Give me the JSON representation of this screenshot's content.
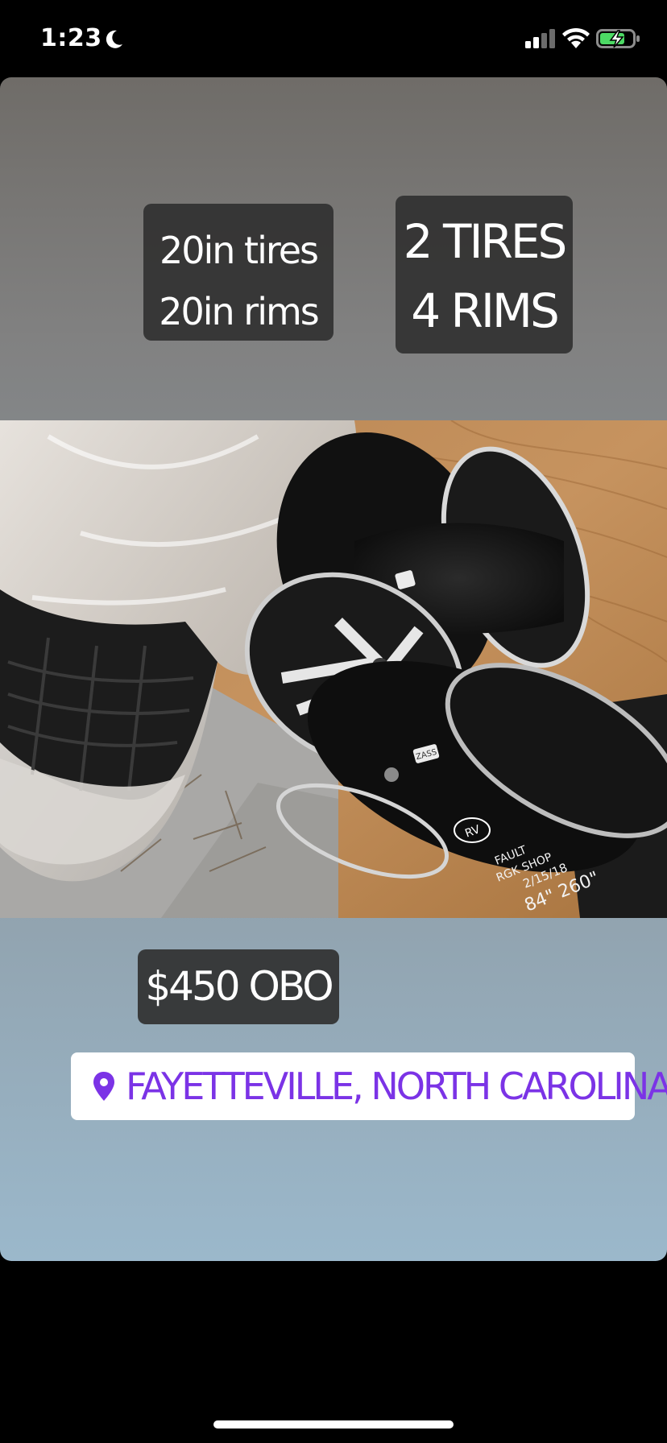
{
  "status_bar": {
    "time": "1:23",
    "icons": [
      "moon-icon",
      "signal-icon",
      "wifi-icon",
      "battery-charging-icon"
    ],
    "battery_color": "#4cd964"
  },
  "story": {
    "stickers": {
      "size_line1": "20in tires",
      "size_line2": "20in rims",
      "count_line1": "2 TIRES",
      "count_line2": "4 RIMS",
      "price": "$450 OBO"
    },
    "location": {
      "icon": "map-pin-icon",
      "text": "FAYETTEVILLE, NORTH CAROLINA",
      "color": "#7b33e6"
    },
    "photo": {
      "handwriting_line1": "84\" 260\"",
      "handwriting_line2": "2/15/18",
      "handwriting_line3": "RGK SHOP",
      "handwriting_line4": "FAULT",
      "marker_label": "RV",
      "sticker_label": "ZASS"
    }
  }
}
